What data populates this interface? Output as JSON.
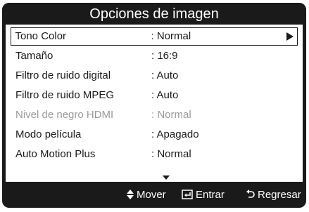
{
  "dialog": {
    "title": "Opciones de imagen"
  },
  "menu": {
    "items": [
      {
        "label": "Tono Color",
        "value": ": Normal",
        "selected": true,
        "disabled": false
      },
      {
        "label": "Tamaño",
        "value": ": 16:9",
        "selected": false,
        "disabled": false
      },
      {
        "label": "Filtro de ruido digital",
        "value": ": Auto",
        "selected": false,
        "disabled": false
      },
      {
        "label": "Filtro de ruido MPEG",
        "value": ": Auto",
        "selected": false,
        "disabled": false
      },
      {
        "label": "Nivel de negro HDMI",
        "value": ": Normal",
        "selected": false,
        "disabled": true
      },
      {
        "label": "Modo película",
        "value": ": Apagado",
        "selected": false,
        "disabled": false
      },
      {
        "label": "Auto Motion Plus",
        "value": ": Normal",
        "selected": false,
        "disabled": false
      }
    ]
  },
  "footer": {
    "move_label": "Mover",
    "enter_label": "Entrar",
    "return_label": "Regresar"
  },
  "icons": {
    "submenu": "triangle-right-icon",
    "scroll_more": "triangle-down-icon",
    "move": "up-down-arrows-icon",
    "enter": "enter-icon",
    "return": "return-icon"
  },
  "colors": {
    "frame": "#1a1a1a",
    "panel": "#ffffff",
    "text": "#1a1a1a",
    "disabled_text": "#9a9a9a"
  }
}
